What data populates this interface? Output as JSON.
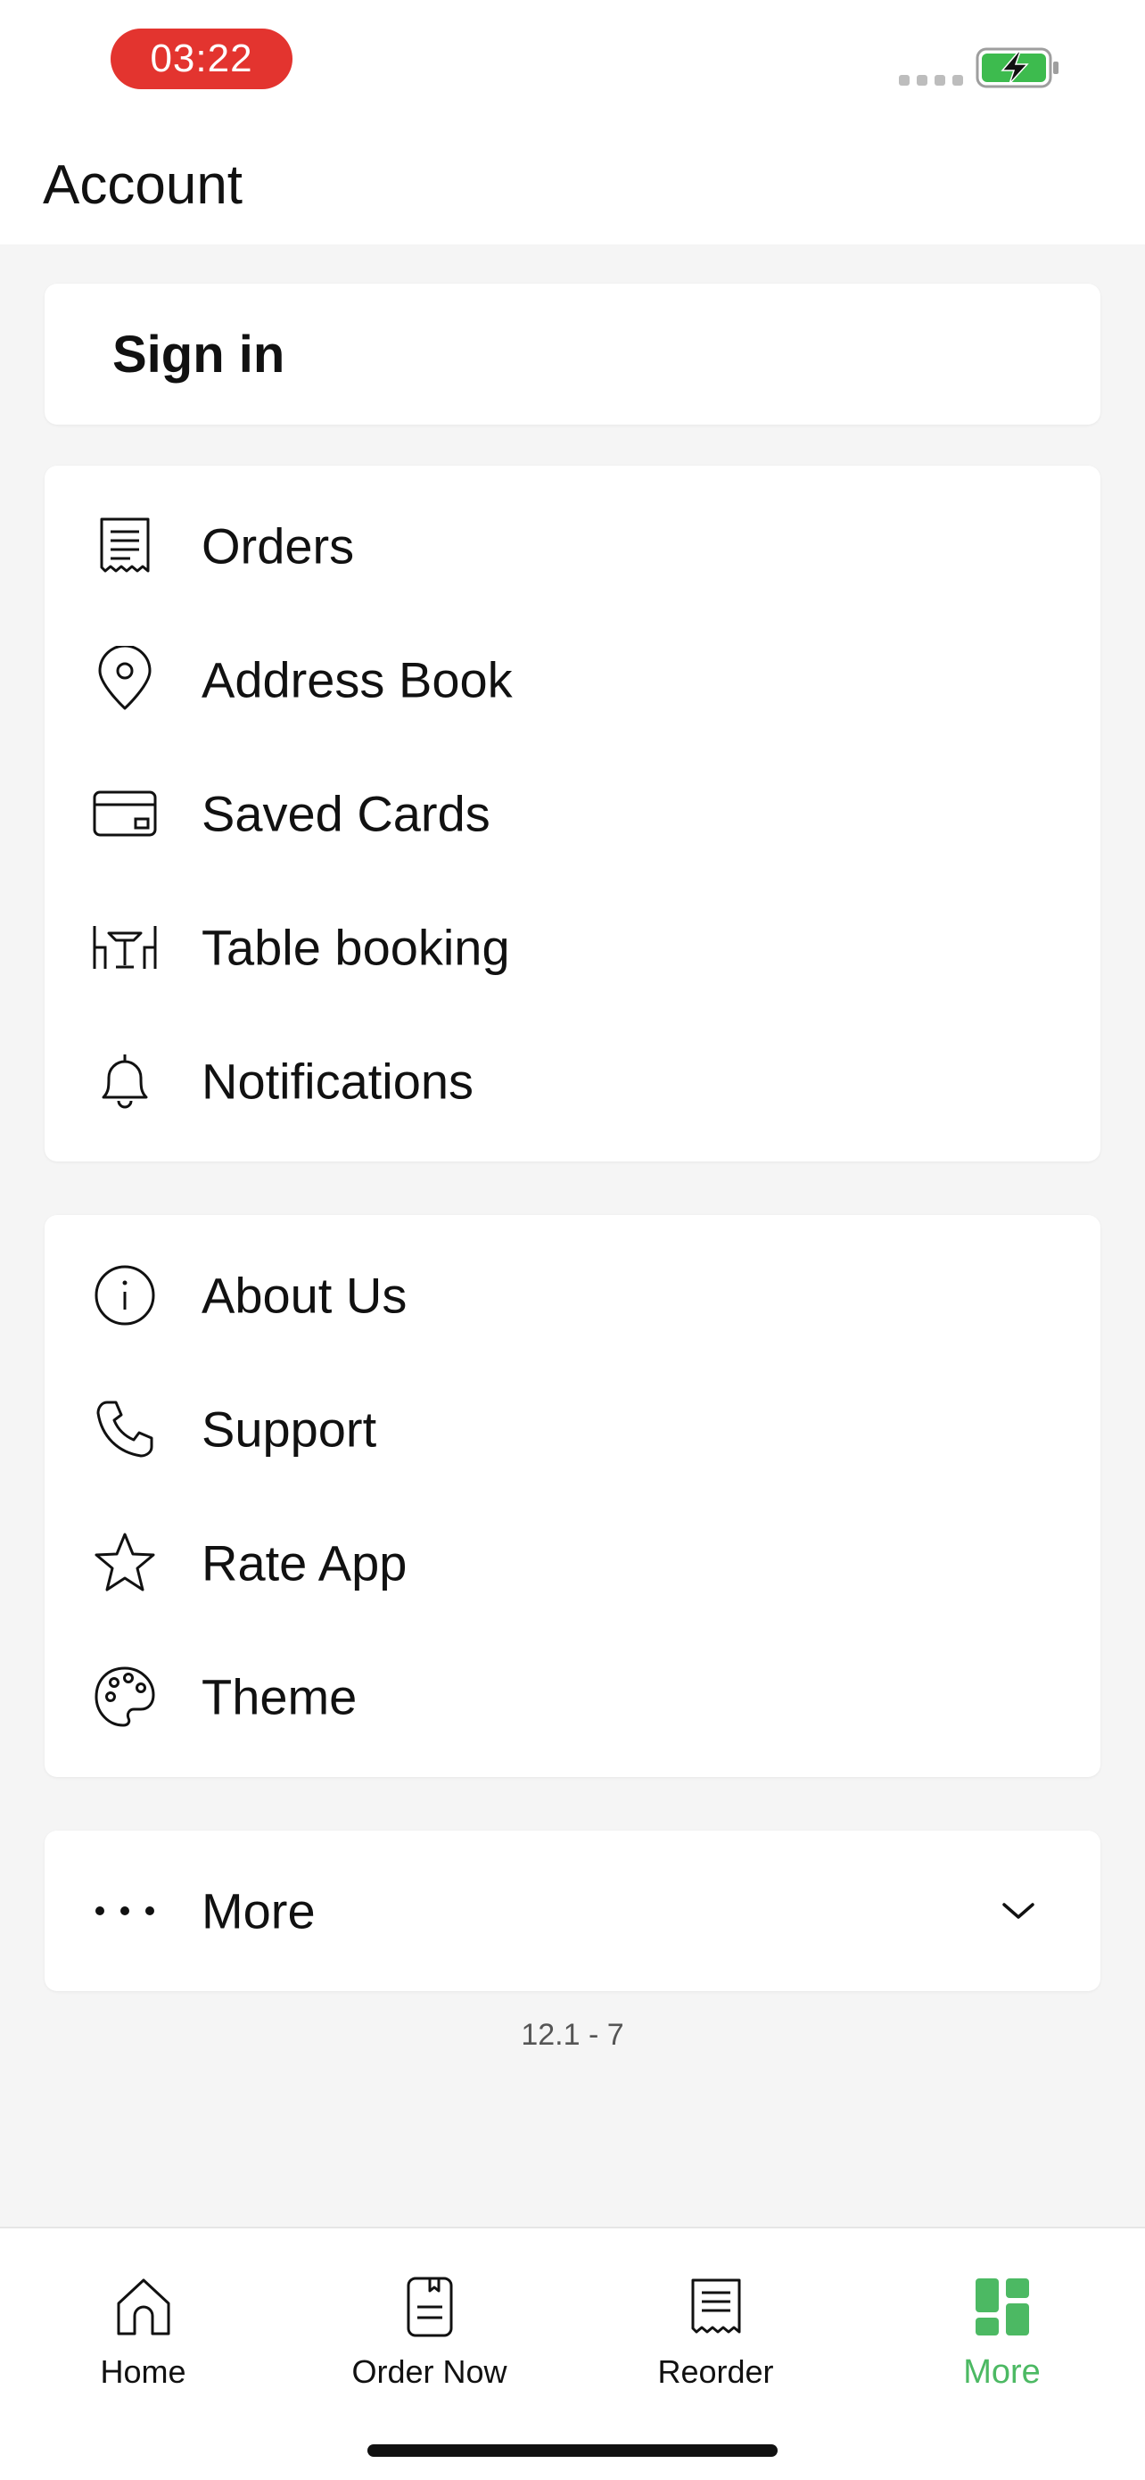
{
  "status_bar": {
    "time": "03:22",
    "time_pill_color": "#e3342f",
    "battery_color": "#3dbb4e"
  },
  "header": {
    "title": "Account"
  },
  "signin": {
    "label": "Sign in"
  },
  "menu_group_1": {
    "items": [
      {
        "label": "Orders",
        "icon": "receipt-icon"
      },
      {
        "label": "Address Book",
        "icon": "location-pin-icon"
      },
      {
        "label": "Saved Cards",
        "icon": "credit-card-icon"
      },
      {
        "label": "Table booking",
        "icon": "table-dining-icon"
      },
      {
        "label": "Notifications",
        "icon": "bell-icon"
      }
    ]
  },
  "menu_group_2": {
    "items": [
      {
        "label": "About Us",
        "icon": "info-icon"
      },
      {
        "label": "Support",
        "icon": "phone-icon"
      },
      {
        "label": "Rate App",
        "icon": "star-icon"
      },
      {
        "label": "Theme",
        "icon": "palette-icon"
      }
    ]
  },
  "more": {
    "label": "More",
    "icon": "ellipsis-icon",
    "chevron": "chevron-down-icon"
  },
  "version": "12.1 - 7",
  "tabbar": {
    "active_color": "#4cb963",
    "tabs": [
      {
        "label": "Home",
        "icon": "home-icon",
        "active": false
      },
      {
        "label": "Order Now",
        "icon": "order-book-icon",
        "active": false
      },
      {
        "label": "Reorder",
        "icon": "receipt-icon",
        "active": false
      },
      {
        "label": "More",
        "icon": "grid-icon",
        "active": true
      }
    ]
  }
}
